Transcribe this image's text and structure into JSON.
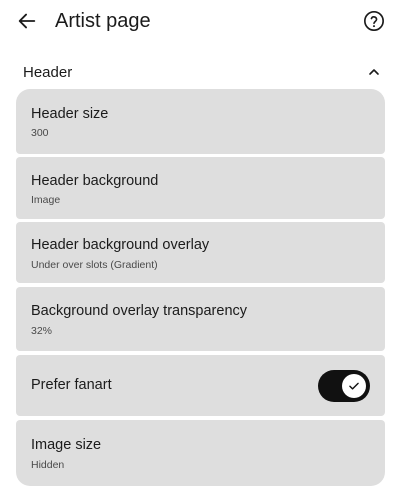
{
  "app_bar": {
    "title": "Artist page",
    "back_icon": "arrow-left-icon",
    "help_icon": "help-circle-icon"
  },
  "section": {
    "title": "Header",
    "expanded": true,
    "chevron_icon": "chevron-up-icon"
  },
  "settings": [
    {
      "title": "Header size",
      "value": "300"
    },
    {
      "title": "Header background",
      "value": "Image"
    },
    {
      "title": "Header background overlay",
      "value": "Under over slots (Gradient)"
    },
    {
      "title": "Background overlay transparency",
      "value": "32%"
    },
    {
      "title": "Prefer fanart",
      "toggle_on": true,
      "toggle_icon": "check-icon"
    },
    {
      "title": "Image size",
      "value": "Hidden"
    }
  ],
  "colors": {
    "card_background": "#dedede",
    "toggle_on": "#111111",
    "text_primary": "#1b1b1b",
    "text_secondary": "#4a4a4a"
  }
}
